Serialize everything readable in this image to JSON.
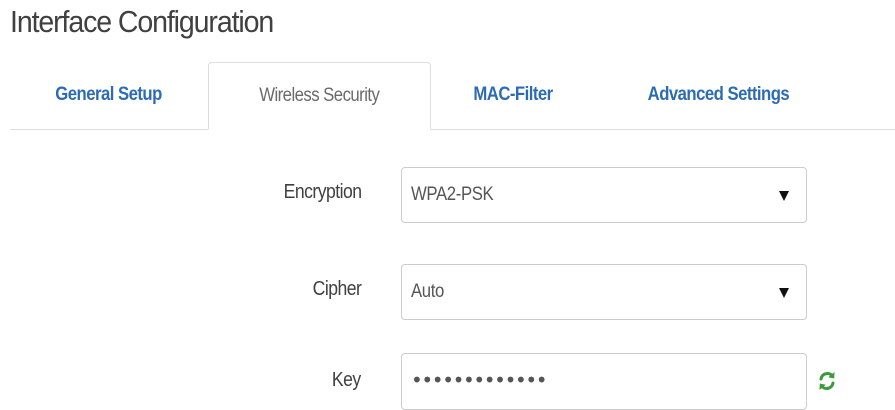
{
  "page": {
    "title": "Interface Configuration"
  },
  "tabs": [
    {
      "label": "General Setup",
      "active": false
    },
    {
      "label": "Wireless Security",
      "active": true
    },
    {
      "label": "MAC-Filter",
      "active": false
    },
    {
      "label": "Advanced Settings",
      "active": false
    }
  ],
  "form": {
    "encryption": {
      "label": "Encryption",
      "value": "WPA2-PSK"
    },
    "cipher": {
      "label": "Cipher",
      "value": "Auto"
    },
    "key": {
      "label": "Key",
      "value": "•••••••••••••",
      "icon": "refresh-icon"
    }
  },
  "colors": {
    "tab_link": "#2d6bb5",
    "tab_active_text": "#6a6a6a",
    "text": "#404040",
    "border": "#cccccc",
    "icon_green": "#3c9a3c"
  }
}
